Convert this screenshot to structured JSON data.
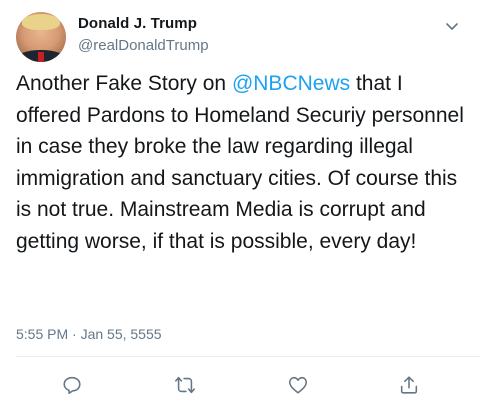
{
  "author": {
    "name": "Donald J. Trump",
    "handle": "@realDonaldTrump"
  },
  "tweet": {
    "text_before_mention": "Another Fake Story on ",
    "mention": "@NBCNews",
    "text_after_mention": " that I offered Pardons to Homeland Securiy personnel in case they broke the law regarding illegal immigration and sanctuary cities. Of course this is not true. Mainstream Media is corrupt and getting worse, if that is possible, every day!",
    "timestamp": "5:55 PM · Jan 55, 5555"
  },
  "icons": {
    "menu": "chevron-down-icon",
    "reply": "reply-icon",
    "retweet": "retweet-icon",
    "like": "heart-icon",
    "share": "share-icon"
  },
  "colors": {
    "link": "#1da1f2",
    "secondary_text": "#657786",
    "icon": "#657786",
    "divider": "#e6ecf0"
  }
}
